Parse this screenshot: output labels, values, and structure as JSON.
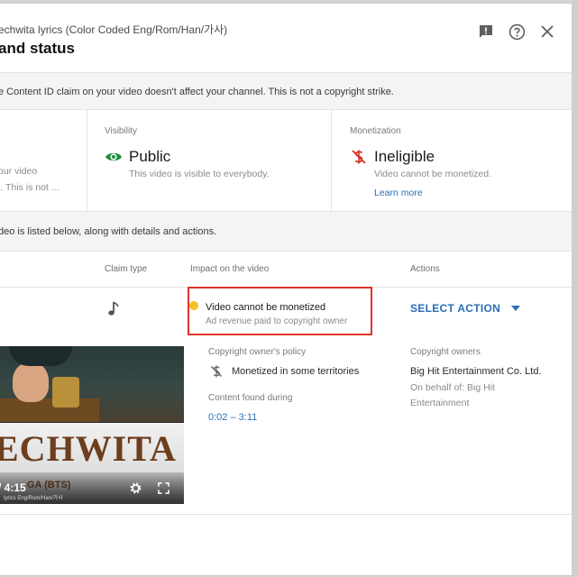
{
  "header": {
    "video_title": "echwita lyrics (Color Coded Eng/Rom/Han/가사)",
    "dialog_title": "and status"
  },
  "banner_top": {
    "text": "e Content ID claim on your video doesn't affect your channel. This is not a copyright strike."
  },
  "summary": {
    "left_partial_line1": "our video",
    "left_partial_line2": "l. This is not ...",
    "visibility": {
      "label": "Visibility",
      "value": "Public",
      "description": "This video is visible to everybody.",
      "icon": "eye-icon",
      "icon_color": "#1e8e3e"
    },
    "monetization": {
      "label": "Monetization",
      "value": "Ineligible",
      "description": "Video cannot be monetized.",
      "link": "Learn more",
      "icon": "no-money-icon",
      "icon_color": "#d93025"
    }
  },
  "banner_mid": {
    "text": "deo is listed below, along with details and actions."
  },
  "table": {
    "col_claim_type": "Claim type",
    "col_impact": "Impact on the video",
    "col_actions": "Actions"
  },
  "claim": {
    "type_icon": "music-note-icon",
    "impact_title": "Video cannot be monetized",
    "impact_sub": "Ad revenue paid to copyright owner",
    "impact_dot_color": "#f6bf26",
    "action_label": "SELECT ACTION",
    "policy_label": "Copyright owner's policy",
    "policy_value": "Monetized in some territories",
    "content_found_label": "Content found during",
    "content_range": "0:02 – 3:11",
    "owners_label": "Copyright owners",
    "owner_name": "Big Hit Entertainment Co. Ltd.",
    "on_behalf_line1": "On behalf of: Big Hit",
    "on_behalf_line2": "Entertainment"
  },
  "thumbnail": {
    "title_word": "ECHWITA",
    "time": "/ 4:15",
    "subtitle": "GA (BTS)",
    "small_caption": "lyrics Eng/Rom/Han/가사"
  },
  "colors": {
    "link_blue": "#2a6fb5",
    "highlight_red": "#e0332b"
  }
}
